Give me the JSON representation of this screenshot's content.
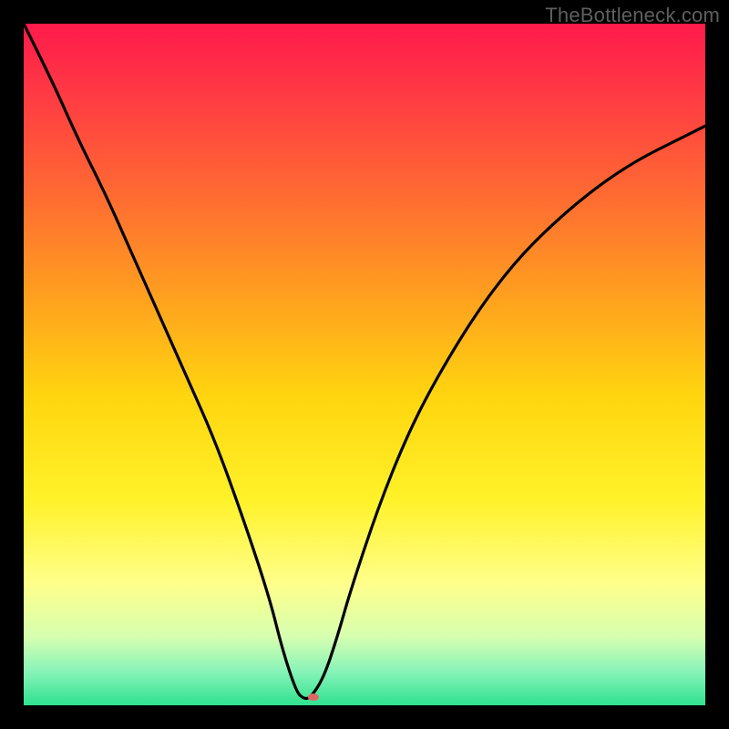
{
  "watermark": "TheBottleneck.com",
  "chart_data": {
    "type": "line",
    "title": "",
    "xlabel": "",
    "ylabel": "",
    "xlim": [
      0,
      100
    ],
    "ylim": [
      0,
      100
    ],
    "grid": false,
    "background_gradient": {
      "stops": [
        {
          "offset": 0.0,
          "color": "#ff1a4b"
        },
        {
          "offset": 0.1,
          "color": "#ff3944"
        },
        {
          "offset": 0.25,
          "color": "#ff6a32"
        },
        {
          "offset": 0.4,
          "color": "#ffa01f"
        },
        {
          "offset": 0.55,
          "color": "#ffd60f"
        },
        {
          "offset": 0.7,
          "color": "#fff22a"
        },
        {
          "offset": 0.82,
          "color": "#ffff8a"
        },
        {
          "offset": 0.9,
          "color": "#d6ffb0"
        },
        {
          "offset": 0.95,
          "color": "#88f3b8"
        },
        {
          "offset": 1.0,
          "color": "#2fe28f"
        }
      ]
    },
    "series": [
      {
        "name": "bottleneck-curve",
        "x": [
          0,
          4,
          8,
          12,
          16,
          20,
          24,
          28,
          32,
          36,
          38,
          40,
          41,
          42,
          44,
          46,
          48,
          52,
          56,
          60,
          66,
          72,
          78,
          84,
          90,
          96,
          100
        ],
        "y": [
          100,
          92,
          83,
          75,
          66,
          57,
          48,
          39,
          28,
          16,
          8,
          2,
          1,
          1,
          4,
          10,
          17,
          29,
          39,
          47,
          57,
          65,
          71,
          76,
          80,
          83,
          85
        ]
      }
    ],
    "marker": {
      "x": 42.5,
      "y": 1.2,
      "color": "#e06666",
      "rx": 6,
      "ry": 4
    }
  }
}
